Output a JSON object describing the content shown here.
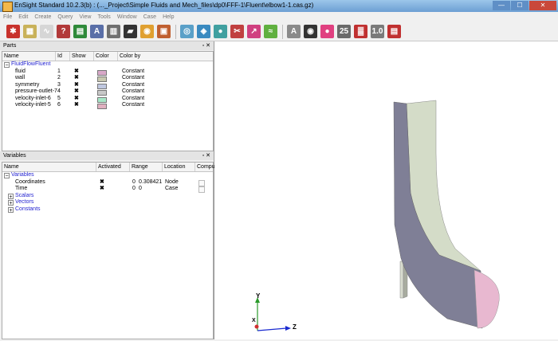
{
  "window": {
    "title": "EnSight Standard 10.2.3(b) : (..._Project\\Simple Fluids and Mech_files\\dp0\\FFF-1\\Fluent\\elbow1-1.cas.gz)",
    "min_label": "—",
    "max_label": "☐",
    "close_label": "✕"
  },
  "menu": [
    "File",
    "Edit",
    "Create",
    "Query",
    "View",
    "Tools",
    "Window",
    "Case",
    "Help"
  ],
  "toolbar": {
    "icons": [
      {
        "name": "parts-icon",
        "glyph": "✱",
        "color": "#c8322c"
      },
      {
        "name": "table-icon",
        "glyph": "▦",
        "color": "#c9b25a"
      },
      {
        "name": "plot-icon",
        "glyph": "∿",
        "color": "#d6d6d6"
      },
      {
        "name": "query-icon",
        "glyph": "?",
        "color": "#b23a3a"
      },
      {
        "name": "film-icon",
        "glyph": "▤",
        "color": "#2f8a3a"
      },
      {
        "name": "annotation-icon",
        "glyph": "A",
        "color": "#5a6fa8"
      },
      {
        "name": "book-icon",
        "glyph": "▥",
        "color": "#707070"
      },
      {
        "name": "clapper-icon",
        "glyph": "▰",
        "color": "#333333"
      },
      {
        "name": "camera-icon",
        "glyph": "◉",
        "color": "#e0a030"
      },
      {
        "name": "toolbox-icon",
        "glyph": "▣",
        "color": "#c06030"
      }
    ],
    "icons2": [
      {
        "name": "contour-icon",
        "glyph": "◎",
        "color": "#5aa0c8"
      },
      {
        "name": "isosurface-icon",
        "glyph": "◈",
        "color": "#3a8ac0"
      },
      {
        "name": "drops-icon",
        "glyph": "●",
        "color": "#40a0a0"
      },
      {
        "name": "scissors-icon",
        "glyph": "✂",
        "color": "#c04040"
      },
      {
        "name": "vector-icon",
        "glyph": "↗",
        "color": "#d04080"
      },
      {
        "name": "streamline-icon",
        "glyph": "≈",
        "color": "#60b040"
      }
    ],
    "icons3": [
      {
        "name": "text-icon",
        "glyph": "A",
        "color": "#8a8a8a"
      },
      {
        "name": "eye-icon",
        "glyph": "◉",
        "color": "#333333"
      },
      {
        "name": "color-wheel-icon",
        "glyph": "●",
        "color": "#e04080"
      },
      {
        "name": "number-icon",
        "glyph": "25",
        "color": "#6a6a6a"
      },
      {
        "name": "palette-icon",
        "glyph": "▓",
        "color": "#c03030"
      },
      {
        "name": "scale-icon",
        "glyph": "1.0",
        "color": "#7a7a7a"
      },
      {
        "name": "color-bar-icon",
        "glyph": "▤",
        "color": "#c03030"
      }
    ]
  },
  "parts": {
    "title": "Parts",
    "columns": [
      "Name",
      "Id",
      "Show",
      "Color",
      "Color by"
    ],
    "group": "FluidFlowFluent",
    "rows": [
      {
        "name": "fluid",
        "id": "1",
        "show": "✖",
        "color": "#d8a8c8",
        "color_by": "Constant"
      },
      {
        "name": "wall",
        "id": "2",
        "show": "✖",
        "color": "#c8c8b0",
        "color_by": "Constant"
      },
      {
        "name": "symmetry",
        "id": "3",
        "show": "✖",
        "color": "#c0c8e0",
        "color_by": "Constant"
      },
      {
        "name": "pressure-outlet-7",
        "id": "4",
        "show": "✖",
        "color": "#c8c8c8",
        "color_by": "Constant"
      },
      {
        "name": "velocity-inlet-6",
        "id": "5",
        "show": "✖",
        "color": "#a8e8c8",
        "color_by": "Constant"
      },
      {
        "name": "velocity-inlet-5",
        "id": "6",
        "show": "✖",
        "color": "#e0b0c0",
        "color_by": "Constant"
      }
    ]
  },
  "variables": {
    "title": "Variables",
    "columns": [
      "Name",
      "Activated",
      "Range",
      "Location",
      "Compu"
    ],
    "root": "Variables",
    "rows": [
      {
        "name": "Coordinates",
        "activated": "✖",
        "range_min": "0",
        "range_max": "0.308421",
        "location": "Node"
      },
      {
        "name": "Time",
        "activated": "✖",
        "range_min": "0",
        "range_max": "0",
        "location": "Case"
      }
    ],
    "groups": [
      "Scalars",
      "Vectors",
      "Constants"
    ]
  },
  "panel_controls": "▫ ✕",
  "tree": {
    "minus": "−",
    "plus": "+"
  },
  "axes": {
    "y": "Y",
    "z": "Z",
    "x": "X"
  },
  "colors": {
    "body_side": "#7f7f96",
    "body_front": "#d4dcc8",
    "outlet": "#e8b8d0",
    "inlet_pipe": "#d8dccf"
  }
}
